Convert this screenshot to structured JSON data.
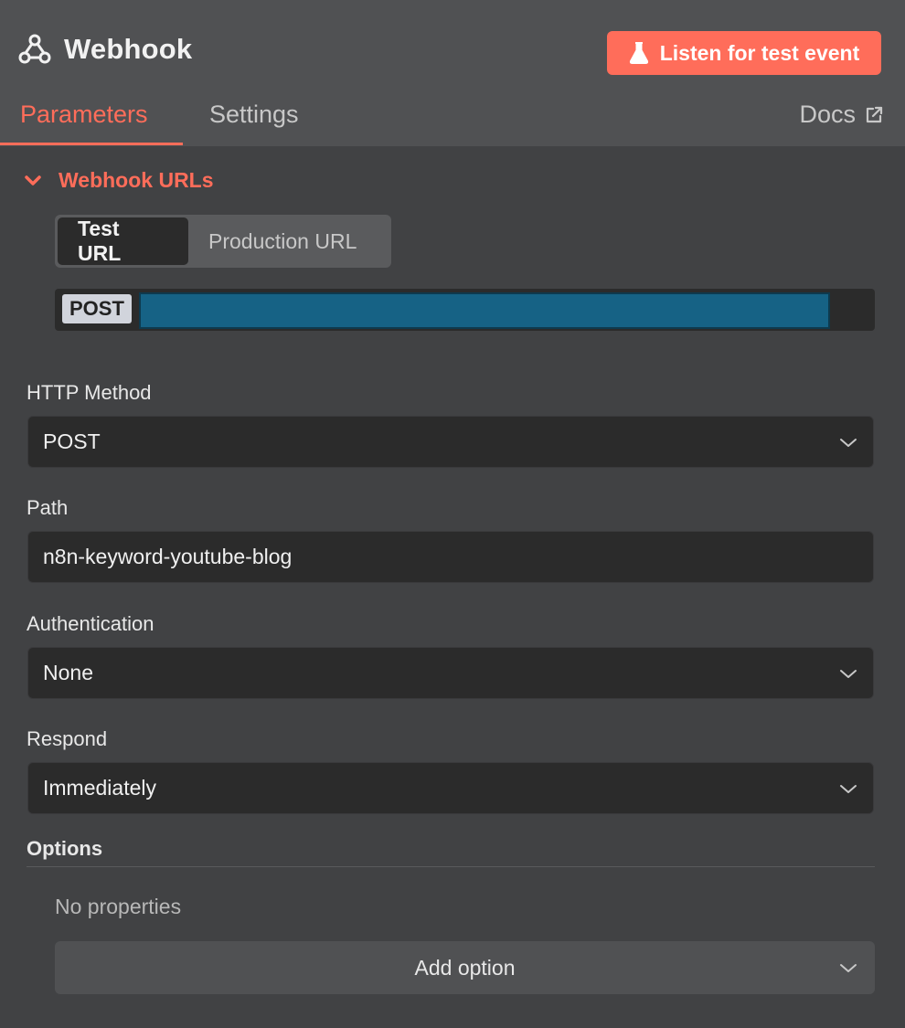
{
  "header": {
    "title": "Webhook",
    "title_icon": "webhook-icon",
    "listen_button": "Listen for test event",
    "listen_icon": "flask-icon"
  },
  "tabs": [
    {
      "label": "Parameters",
      "active": true
    },
    {
      "label": "Settings",
      "active": false
    }
  ],
  "docs": {
    "label": "Docs",
    "icon": "external-link-icon"
  },
  "webhook_urls": {
    "section_title": "Webhook URLs",
    "expanded": true,
    "url_tabs": [
      {
        "label": "Test URL",
        "active": true
      },
      {
        "label": "Production URL",
        "active": false
      }
    ],
    "method": "POST"
  },
  "fields": {
    "http_method": {
      "label": "HTTP Method",
      "value": "POST"
    },
    "path": {
      "label": "Path",
      "value": "n8n-keyword-youtube-blog"
    },
    "authentication": {
      "label": "Authentication",
      "value": "None"
    },
    "respond": {
      "label": "Respond",
      "value": "Immediately"
    }
  },
  "options": {
    "label": "Options",
    "empty_text": "No properties",
    "add_button": "Add option"
  },
  "colors": {
    "accent": "#ff6d5a",
    "background": "#414244",
    "header": "#505153",
    "field": "#2b2b2b",
    "url_redaction": "#166285"
  }
}
